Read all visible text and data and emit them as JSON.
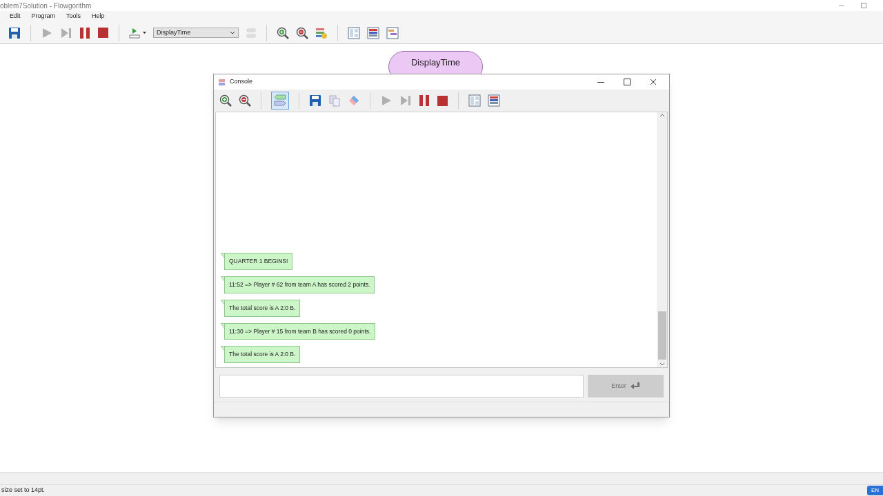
{
  "window": {
    "title": "oblem7Solution - Flowgorithm"
  },
  "menu": [
    "Edit",
    "Program",
    "Tools",
    "Help"
  ],
  "toolbar": {
    "function_select": "DisplayTime"
  },
  "flowchart": {
    "node_title": "DisplayTime"
  },
  "console": {
    "title": "Console",
    "chat_view": {
      "selected": true
    },
    "messages": [
      "QUARTER 1 BEGINS!",
      "11:52 => Player # 62 from team A has scored 2 points.",
      "The total score is A 2:0 B.",
      "11:30 => Player # 15 from team B has scored 0 points.",
      "The total score is A 2:0 B."
    ],
    "enter_button": {
      "label": "Enter",
      "disabled": true
    }
  },
  "status_bar": "size set to 14pt.",
  "taskbar": {
    "language": "EN"
  }
}
